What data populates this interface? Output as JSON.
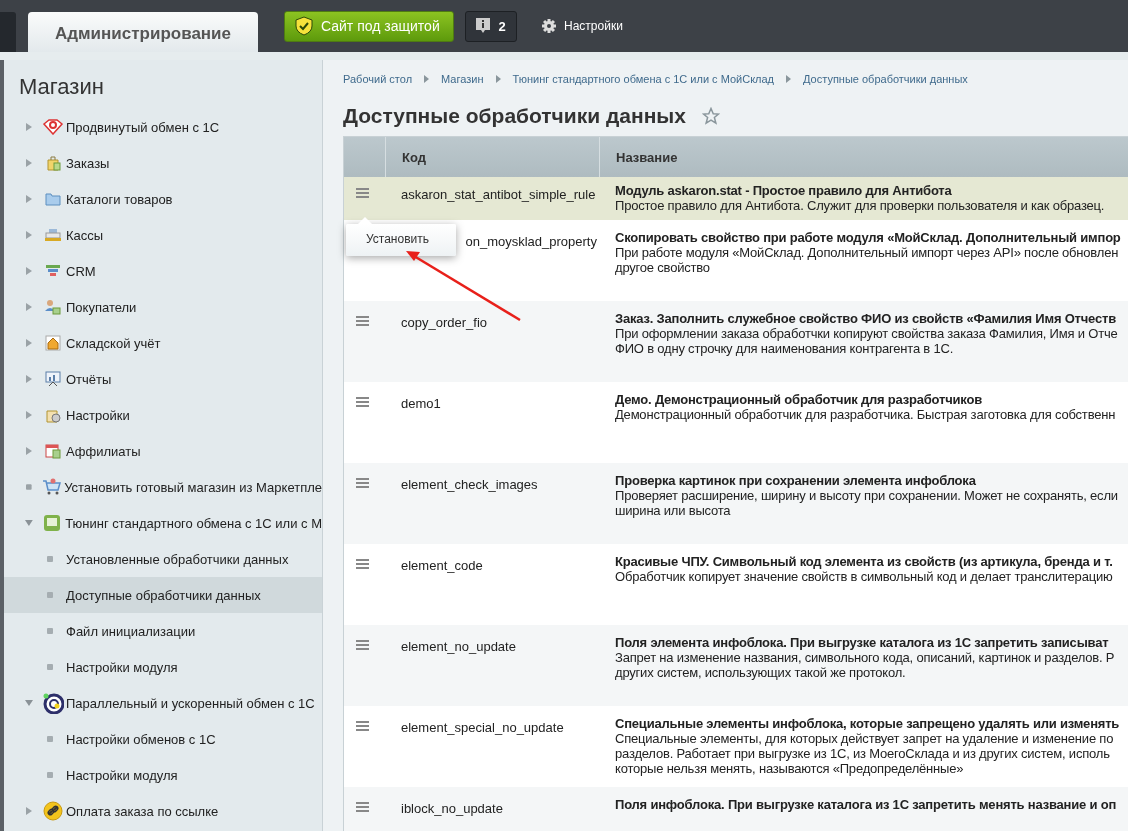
{
  "topbar": {
    "tabs": [
      {
        "label": "Администрирование",
        "selected": true
      }
    ],
    "security_button": {
      "label": "Сайт под защитой"
    },
    "notifications": {
      "count": "2"
    },
    "settings": {
      "label": "Настройки"
    }
  },
  "sidebar": {
    "title": "Магазин",
    "items": [
      {
        "label": "Продвинутый обмен с 1С",
        "kind": "group",
        "expanded": false,
        "selected": false
      },
      {
        "label": "Заказы",
        "kind": "group",
        "expanded": false,
        "selected": false
      },
      {
        "label": "Каталоги товаров",
        "kind": "group",
        "expanded": false,
        "selected": false
      },
      {
        "label": "Кассы",
        "kind": "group",
        "expanded": false,
        "selected": false
      },
      {
        "label": "CRM",
        "kind": "group",
        "expanded": false,
        "selected": false
      },
      {
        "label": "Покупатели",
        "kind": "group",
        "expanded": false,
        "selected": false
      },
      {
        "label": "Складской учёт",
        "kind": "group",
        "expanded": false,
        "selected": false
      },
      {
        "label": "Отчёты",
        "kind": "group",
        "expanded": false,
        "selected": false
      },
      {
        "label": "Настройки",
        "kind": "group",
        "expanded": false,
        "selected": false
      },
      {
        "label": "Аффилиаты",
        "kind": "group",
        "expanded": false,
        "selected": false
      },
      {
        "label": "Установить готовый магазин из Маркетпле",
        "kind": "link",
        "selected": false
      },
      {
        "label": "Тюнинг стандартного обмена с 1С или с М",
        "kind": "group",
        "expanded": true,
        "selected": false,
        "children": [
          {
            "label": "Установленные обработчики данных",
            "selected": false
          },
          {
            "label": "Доступные обработчики данных",
            "selected": true
          },
          {
            "label": "Файл инициализации",
            "selected": false
          },
          {
            "label": "Настройки модуля",
            "selected": false
          }
        ]
      },
      {
        "label": "Параллельный и ускоренный обмен с 1С",
        "kind": "group",
        "expanded": true,
        "selected": false,
        "children": [
          {
            "label": "Настройки обменов с 1С",
            "selected": false
          },
          {
            "label": "Настройки модуля",
            "selected": false
          }
        ]
      },
      {
        "label": "Оплата заказа по ссылке",
        "kind": "group",
        "expanded": false,
        "selected": false
      }
    ]
  },
  "breadcrumbs": [
    "Рабочий стол",
    "Магазин",
    "Тюнинг стандартного обмена с 1С или с МойСклад",
    "Доступные обработчики данных"
  ],
  "page_title": "Доступные обработчики данных",
  "table": {
    "columns": [
      "Код",
      "Название"
    ],
    "rows": [
      {
        "code": "askaron_stat_antibot_simple_rule",
        "title": "Модуль askaron.stat - Простое правило для Антибота",
        "description": [
          "Простое правило для Антибота. Служит для проверки пользователя и как образец."
        ],
        "selected": true,
        "menu_open": true,
        "menu_items": [
          "Установить"
        ]
      },
      {
        "code": "on_moysklad_property",
        "title": "Скопировать свойство при работе модуля «МойСклад. Дополнительный импор",
        "description": [
          "При работе модуля «МойСклад. Дополнительный импорт через API» после обновлен",
          "другое свойство"
        ],
        "selected": false,
        "menu_open": false
      },
      {
        "code": "copy_order_fio",
        "title": "Заказ. Заполнить служебное свойство ФИО из свойств «Фамилия Имя Отчеств",
        "description": [
          "При оформлении заказа обработчки копируют свойства заказа Фамилия, Имя и Отче",
          "ФИО в одну строчку для наименования контрагента в 1С."
        ],
        "selected": false,
        "menu_open": false
      },
      {
        "code": "demo1",
        "title": "Демо. Демонстрационный обработчик для разработчиков",
        "description": [
          "Демонстрационный обработчик для разработчика. Быстрая заготовка для собственн"
        ],
        "selected": false,
        "menu_open": false
      },
      {
        "code": "element_check_images",
        "title": "Проверка картинок при сохранении элемента инфоблока",
        "description": [
          "Проверяет расширение, ширину и высоту при сохранении. Может не сохранять, если",
          "ширина или высота"
        ],
        "selected": false,
        "menu_open": false
      },
      {
        "code": "element_code",
        "title": "Красивые ЧПУ. Символьный код элемента из свойств (из артикула, бренда и т.",
        "description": [
          "Обработчик копирует значение свойств в символьный код и делает транслитерацию"
        ],
        "selected": false,
        "menu_open": false
      },
      {
        "code": "element_no_update",
        "title": "Поля элемента инфоблока. При выгрузке каталога из 1С запретить записыват",
        "description": [
          "Запрет на изменение названия, символьного кода, описаний, картинок и разделов. Р",
          "других систем, использующих такой же протокол."
        ],
        "selected": false,
        "menu_open": false
      },
      {
        "code": "element_special_no_update",
        "title": "Специальные элементы инфоблока, которые запрещено удалять или изменять",
        "description": [
          "Специальные элементы, для которых действует запрет на удаление и изменение по",
          "разделов. Работает при выгрузке из 1С, из МоегоСклада и из других систем, исполь",
          "которые нельзя менять, называются «Предопределённые»"
        ],
        "selected": false,
        "menu_open": false
      },
      {
        "code": "iblock_no_update",
        "title": "Поля инфоблока. При выгрузке каталога из 1С запретить менять название и оп",
        "description": [],
        "selected": false,
        "menu_open": false
      }
    ]
  }
}
